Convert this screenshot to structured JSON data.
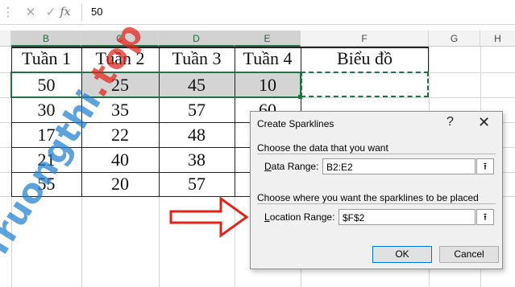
{
  "formula_bar": {
    "cancel_icon": "close-icon",
    "cancel_glyph": "✕",
    "confirm_icon": "check-icon",
    "confirm_glyph": "✓",
    "fx_label": "fx",
    "value": "50"
  },
  "columns": [
    "B",
    "C",
    "D",
    "E",
    "F",
    "G",
    "H"
  ],
  "table": {
    "headers": [
      "Tuần 1",
      "Tuần 2",
      "Tuần 3",
      "Tuần 4",
      "Biểu đồ"
    ],
    "rows": [
      [
        "50",
        "25",
        "45",
        "10"
      ],
      [
        "30",
        "35",
        "57",
        "60"
      ],
      [
        "17",
        "22",
        "48",
        ""
      ],
      [
        "21",
        "40",
        "38",
        ""
      ],
      [
        "55",
        "20",
        "57",
        ""
      ]
    ]
  },
  "watermarks": {
    "left_part1": "Truongthi",
    "left_part2": ".top",
    "right_text": "uantrimang"
  },
  "dialog": {
    "title": "Create Sparklines",
    "help_glyph": "?",
    "close_glyph": "✕",
    "section1": "Choose the data that you want",
    "data_range_label_pre": "",
    "data_range_label_u": "D",
    "data_range_label_post": "ata Range:",
    "data_range_value": "B2:E2",
    "section2": "Choose where you want the sparklines to be placed",
    "location_label_pre": "",
    "location_label_u": "L",
    "location_label_post": "ocation Range:",
    "location_value": "$F$2",
    "picker_glyph": "⭱",
    "ok_label": "OK",
    "cancel_label": "Cancel"
  },
  "colors": {
    "excel_green": "#217346",
    "arrow_red": "#e2231a"
  }
}
